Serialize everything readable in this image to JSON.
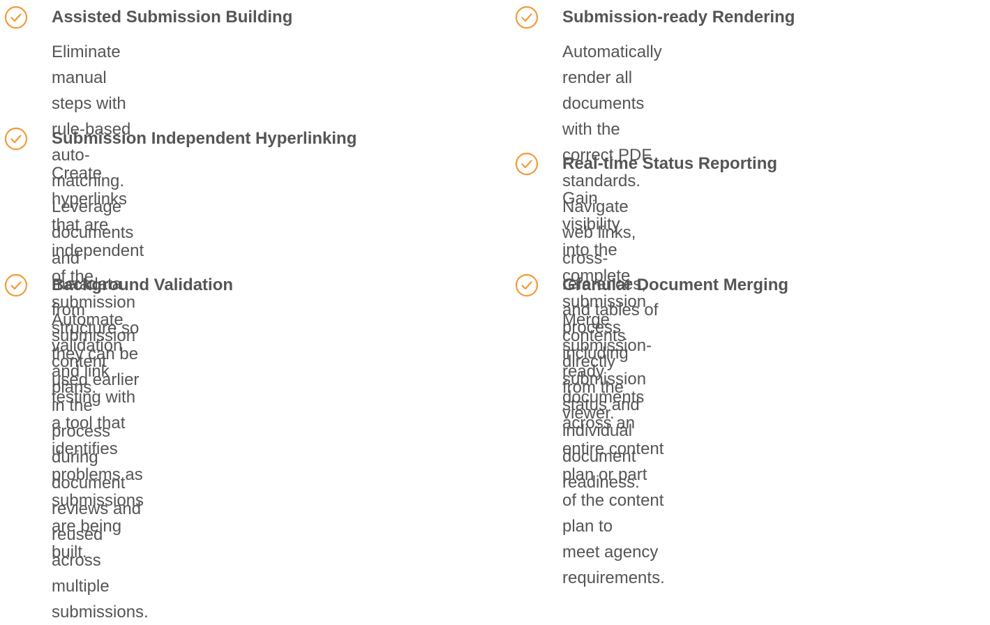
{
  "colors": {
    "accent": "#F39A36",
    "text": "#555555"
  },
  "features": [
    {
      "icon": "check-circle-icon",
      "title": "Assisted Submission Building",
      "description": "Eliminate manual steps with rule-based auto-\nmatching. Leverage documents and metadata\nfrom submission content plans."
    },
    {
      "icon": "check-circle-icon",
      "title": "Submission Independent Hyperlinking",
      "description": "Create hyperlinks that are independent of the\nsubmission structure so they can be used earlier\nin the process during document reviews and\n reused across multiple submissions."
    },
    {
      "icon": "check-circle-icon",
      "title": "Background Validation",
      "description": "Automate validation and link testing with a tool that\nidentifies problems as submissions are being built."
    },
    {
      "icon": "check-circle-icon",
      "title": "Submission-ready Rendering",
      "description": "Automatically render all documents with the\ncorrect PDF standards. Navigate web links,\ncross-references, and tables of contents directly\nfrom the viewer."
    },
    {
      "icon": "check-circle-icon",
      "title": "Real-time Status Reporting",
      "description": "Gain visibility into the complete submission\nprocess including submission status and individual\ndocument readiness."
    },
    {
      "icon": "check-circle-icon",
      "title": "Granular Document Merging",
      "description": "Merge submission-ready documents across an\nentire content plan or part of the content plan to\nmeet agency requirements."
    }
  ]
}
